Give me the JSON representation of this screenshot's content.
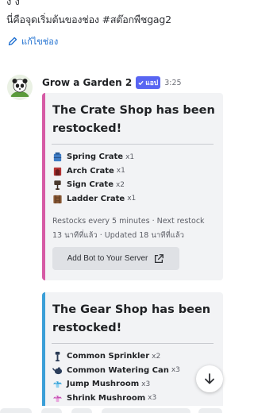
{
  "channel": {
    "cut_text": "ง ง",
    "intro": "นี่คือจุดเริ่มต้นของช่อง #สต๊อกพืชgag2",
    "edit_label": "แก้ไขช่อง"
  },
  "message": {
    "bot_name": "Grow a Garden 2",
    "app_badge": "แอป",
    "timestamp": "3:25"
  },
  "crate_embed": {
    "title": "The Crate Shop has been restocked!",
    "accent": "#d65aa5",
    "items": [
      {
        "name": "Spring Crate",
        "qty": "x1",
        "icon": "blue-crate-icon"
      },
      {
        "name": "Arch Crate",
        "qty": "x1",
        "icon": "red-crate-icon"
      },
      {
        "name": "Sign Crate",
        "qty": "x2",
        "icon": "sign-crate-icon"
      },
      {
        "name": "Ladder Crate",
        "qty": "x1",
        "icon": "ladder-crate-icon"
      }
    ],
    "footer_line1": "Restocks every 5 minutes · Next restock",
    "footer_line2": "13 นาทีที่แล้ว · Updated 18 นาทีที่แล้ว",
    "button_label": "Add Bot to Your Server"
  },
  "gear_embed": {
    "title": "The Gear Shop has been restocked!",
    "accent": "#3b9fd8",
    "items": [
      {
        "name": "Common Sprinkler",
        "qty": "x2",
        "icon": "sprinkler-icon"
      },
      {
        "name": "Common Watering Can",
        "qty": "x3",
        "icon": "watering-can-icon"
      },
      {
        "name": "Jump Mushroom",
        "qty": "x3",
        "icon": "jump-mushroom-icon"
      },
      {
        "name": "Shrink Mushroom",
        "qty": "x3",
        "icon": "shrink-mushroom-icon"
      }
    ]
  }
}
